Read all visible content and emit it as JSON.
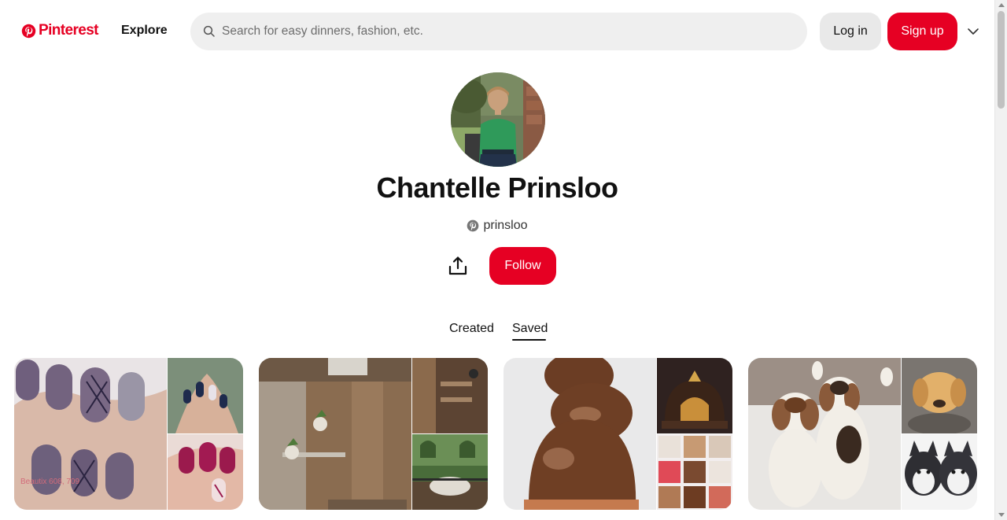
{
  "header": {
    "logo_text": "Pinterest",
    "explore_label": "Explore",
    "search_placeholder": "Search for easy dinners, fashion, etc.",
    "login_label": "Log in",
    "signup_label": "Sign up",
    "brand_color": "#e60023"
  },
  "profile": {
    "name": "Chantelle Prinsloo",
    "handle": "prinsloo",
    "follow_label": "Follow"
  },
  "tabs": [
    {
      "label": "Created",
      "active": false
    },
    {
      "label": "Saved",
      "active": true
    }
  ],
  "boards": [
    {
      "image_text": "Beautix 608, 709"
    },
    {},
    {},
    {}
  ],
  "icons": {
    "logo": "pinterest-logo-icon",
    "search": "search-icon",
    "menu": "chevron-down-icon",
    "handle": "pinterest-badge-icon",
    "share": "share-icon"
  }
}
